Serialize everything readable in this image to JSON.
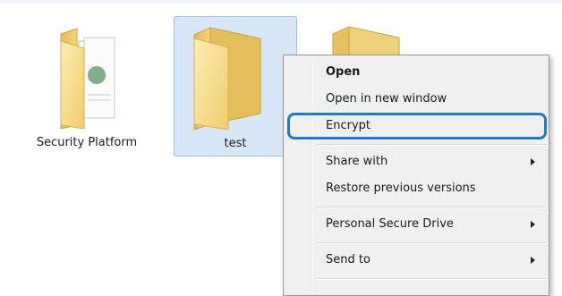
{
  "files": [
    {
      "name": "Security Platform",
      "icon": "folder-with-documents-icon"
    },
    {
      "name": "test",
      "icon": "folder-icon",
      "selected": true
    },
    {
      "name": "",
      "icon": "folder-icon"
    }
  ],
  "context_menu": {
    "items": [
      {
        "label": "Open",
        "bold": true
      },
      {
        "label": "Open in new window"
      },
      {
        "label": "Encrypt",
        "highlighted": true
      },
      {
        "label": "Share with",
        "submenu": true
      },
      {
        "label": "Restore previous versions"
      },
      {
        "label": "Personal Secure Drive",
        "submenu": true
      },
      {
        "label": "Send to",
        "submenu": true
      }
    ]
  },
  "colors": {
    "selection_fill": "#d8e7f8",
    "selection_border": "#9cc0e8",
    "highlight_ring": "#1f7bc2",
    "menu_background": "#f0f0f0",
    "folder_light": "#fbe49e",
    "folder_dark": "#e9c563"
  }
}
